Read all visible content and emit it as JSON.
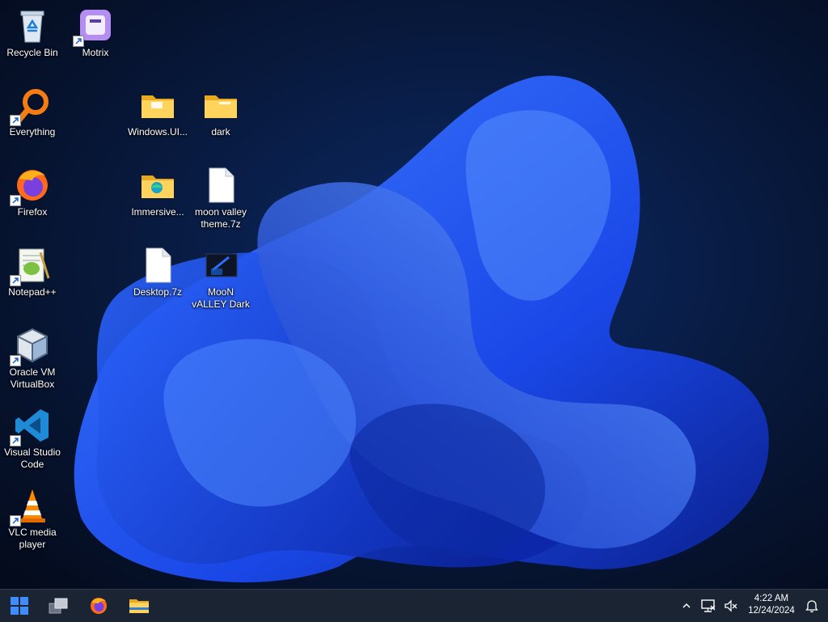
{
  "desktop": {
    "icons": [
      {
        "label": "Recycle Bin"
      },
      {
        "label": "Motrix"
      },
      {
        "label": "Everything"
      },
      {
        "label": "Windows.UI..."
      },
      {
        "label": "dark"
      },
      {
        "label": "Firefox"
      },
      {
        "label": "Immersive..."
      },
      {
        "label": "moon valley\ntheme.7z"
      },
      {
        "label": "Notepad++"
      },
      {
        "label": "Desktop.7z"
      },
      {
        "label": "MooN\nvALLEY Dark"
      },
      {
        "label": "Oracle VM\nVirtualBox"
      },
      {
        "label": "Visual Studio\nCode"
      },
      {
        "label": "VLC media\nplayer"
      }
    ]
  },
  "taskbar": {
    "pinned": [
      "start-icon",
      "task-view-icon",
      "firefox-icon",
      "file-explorer-icon"
    ],
    "tray": [
      "chevron-up-icon",
      "network-icon",
      "volume-muted-icon",
      "notification-bell-icon"
    ],
    "clock": {
      "time": "4:22 AM",
      "date": "12/24/2024"
    }
  },
  "colors": {
    "accent": "#1f5bff",
    "taskbar": "#1b2433",
    "background": "#071229"
  }
}
